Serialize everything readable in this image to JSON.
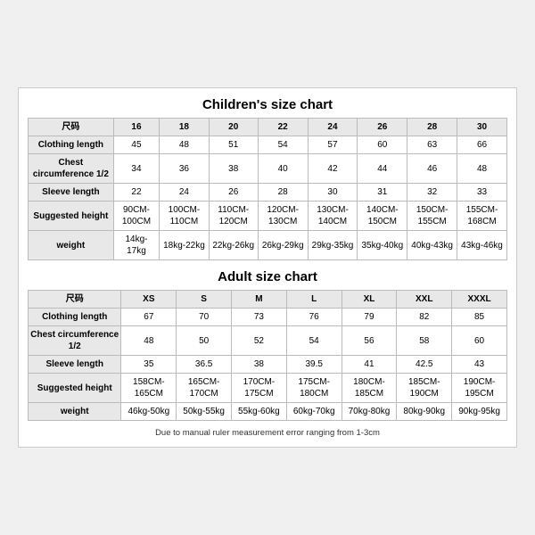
{
  "children_chart": {
    "title": "Children's size chart",
    "headers": [
      "尺码",
      "16",
      "18",
      "20",
      "22",
      "24",
      "26",
      "28",
      "30"
    ],
    "rows": [
      {
        "label": "Clothing length",
        "values": [
          "45",
          "48",
          "51",
          "54",
          "57",
          "60",
          "63",
          "66"
        ]
      },
      {
        "label": "Chest circumference 1/2",
        "values": [
          "34",
          "36",
          "38",
          "40",
          "42",
          "44",
          "46",
          "48"
        ]
      },
      {
        "label": "Sleeve length",
        "values": [
          "22",
          "24",
          "26",
          "28",
          "30",
          "31",
          "32",
          "33"
        ]
      },
      {
        "label": "Suggested height",
        "values": [
          "90CM-100CM",
          "100CM-110CM",
          "110CM-120CM",
          "120CM-130CM",
          "130CM-140CM",
          "140CM-150CM",
          "150CM-155CM",
          "155CM-168CM"
        ]
      },
      {
        "label": "weight",
        "values": [
          "14kg-17kg",
          "18kg-22kg",
          "22kg-26kg",
          "26kg-29kg",
          "29kg-35kg",
          "35kg-40kg",
          "40kg-43kg",
          "43kg-46kg"
        ]
      }
    ]
  },
  "adult_chart": {
    "title": "Adult size chart",
    "headers": [
      "尺码",
      "XS",
      "S",
      "M",
      "L",
      "XL",
      "XXL",
      "XXXL"
    ],
    "rows": [
      {
        "label": "Clothing length",
        "values": [
          "67",
          "70",
          "73",
          "76",
          "79",
          "82",
          "85"
        ]
      },
      {
        "label": "Chest circumference 1/2",
        "values": [
          "48",
          "50",
          "52",
          "54",
          "56",
          "58",
          "60"
        ]
      },
      {
        "label": "Sleeve length",
        "values": [
          "35",
          "36.5",
          "38",
          "39.5",
          "41",
          "42.5",
          "43"
        ]
      },
      {
        "label": "Suggested height",
        "values": [
          "158CM-165CM",
          "165CM-170CM",
          "170CM-175CM",
          "175CM-180CM",
          "180CM-185CM",
          "185CM-190CM",
          "190CM-195CM"
        ]
      },
      {
        "label": "weight",
        "values": [
          "46kg-50kg",
          "50kg-55kg",
          "55kg-60kg",
          "60kg-70kg",
          "70kg-80kg",
          "80kg-90kg",
          "90kg-95kg"
        ]
      }
    ]
  },
  "footnote": "Due to manual ruler measurement error ranging from 1-3cm"
}
